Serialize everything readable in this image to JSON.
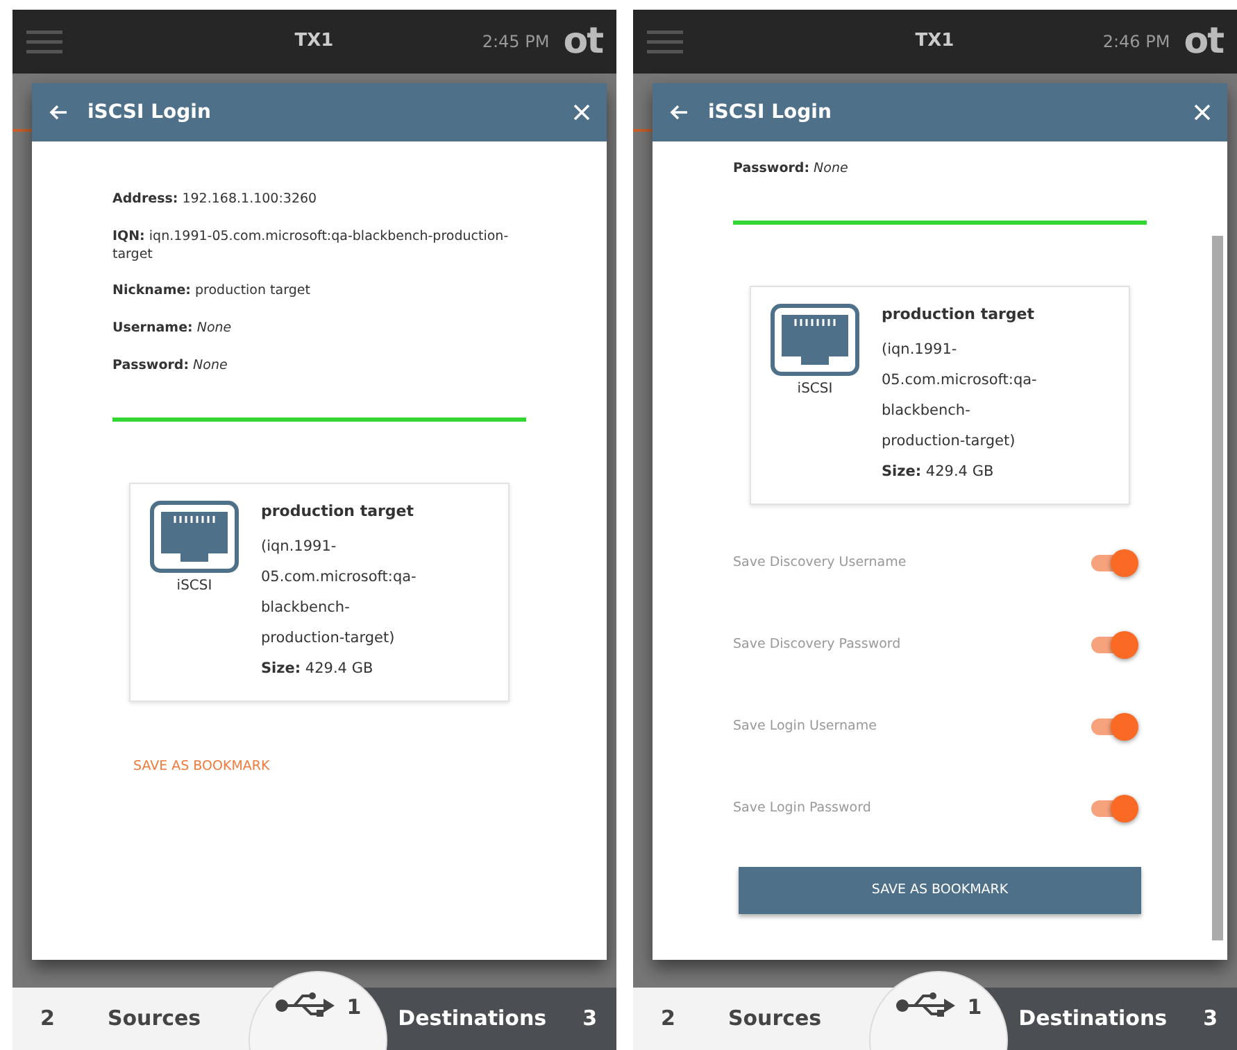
{
  "screens": [
    {
      "top_bar": {
        "title": "TX1",
        "time": "2:45 PM",
        "logo": "ot"
      },
      "dialog": {
        "title": "iSCSI Login",
        "scrollable": false,
        "details": [
          "**Address:** 192.168.1.100:3260",
          "**IQN:** iqn.1991-05.com.microsoft:qa-blackbench-production-target",
          "**Nickname:** production target",
          "**Username:** *None*",
          "**Password:** *None*"
        ],
        "progress": {
          "level": 1
        },
        "target_card": {
          "icon_label": "iSCSI",
          "name": "production target",
          "iqn": "(iqn.1991-05.com.microsoft:qa-blackbench-production-target)",
          "size": "**Size:** 429.4 GB"
        },
        "bookmark": {
          "label": "SAVE AS BOOKMARK",
          "kind": "link"
        }
      },
      "bottom_bar": {
        "sources_count": "2",
        "sources": "Sources",
        "usb_count": "1",
        "destinations": "Destinations",
        "destinations_count": "3"
      }
    },
    {
      "top_bar": {
        "title": "TX1",
        "time": "2:46 PM",
        "logo": "ot"
      },
      "dialog": {
        "title": "iSCSI Login",
        "scrollable": true,
        "details": [
          "**Password:** *None*"
        ],
        "progress": {
          "level": 1
        },
        "target_card": {
          "icon_label": "iSCSI",
          "name": "production target",
          "iqn": "(iqn.1991-05.com.microsoft:qa-blackbench-production-target)",
          "size": "**Size:** 429.4 GB"
        },
        "toggles": [
          {
            "label": "Save Discovery Username",
            "on": true
          },
          {
            "label": "Save Discovery Password",
            "on": true
          },
          {
            "label": "Save Login Username",
            "on": true
          },
          {
            "label": "Save Login Password",
            "on": true
          }
        ],
        "bookmark": {
          "label": "SAVE AS BOOKMARK",
          "kind": "button"
        }
      },
      "bottom_bar": {
        "sources_count": "2",
        "sources": "Sources",
        "usb_count": "1",
        "destinations": "Destinations",
        "destinations_count": "3"
      }
    }
  ]
}
